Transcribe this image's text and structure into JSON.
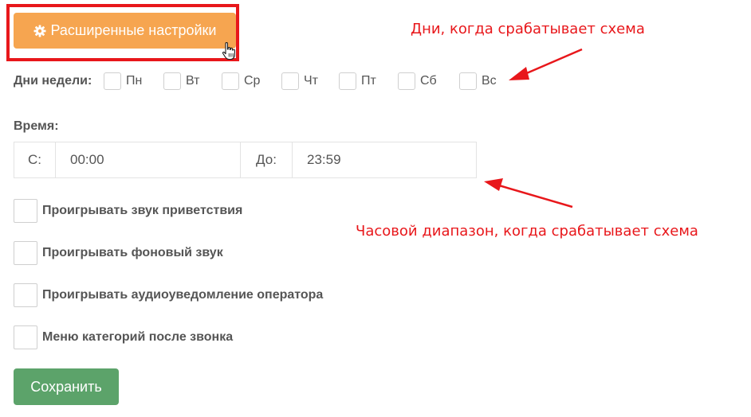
{
  "advanced_button": {
    "label": "Расширенные настройки",
    "icon": "gear-icon"
  },
  "weekdays": {
    "label": "Дни недели:",
    "days": [
      "Пн",
      "Вт",
      "Ср",
      "Чт",
      "Пт",
      "Сб",
      "Вс"
    ]
  },
  "time": {
    "label": "Время:",
    "from_label": "С:",
    "from_value": "00:00",
    "to_label": "До:",
    "to_value": "23:59"
  },
  "options": [
    "Проигрывать звук приветствия",
    "Проигрывать фоновый звук",
    "Проигрывать аудиоуведомление оператора",
    "Меню категорий после звонка"
  ],
  "save_button": {
    "label": "Сохранить"
  },
  "annotations": {
    "days_note": "Дни, когда срабатывает схема",
    "time_note": "Часовой диапазон, когда срабатывает схема"
  },
  "colors": {
    "advanced_button": "#f6a550",
    "save_button": "#5ca36a",
    "annotation": "#e8171b"
  }
}
